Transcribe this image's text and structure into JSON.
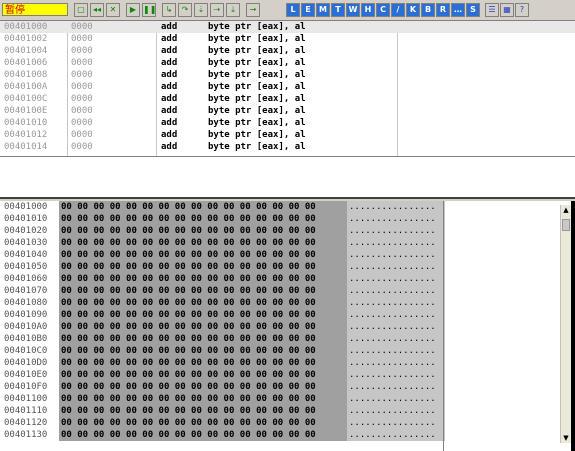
{
  "toolbar": {
    "status_label": "暂停",
    "buttons": [
      {
        "icon": "open-icon",
        "label": "▢"
      },
      {
        "icon": "restart-icon",
        "label": "◂◂"
      },
      {
        "icon": "close-icon",
        "label": "✕"
      },
      {
        "icon": "run-icon",
        "label": "▶"
      },
      {
        "icon": "pause-icon",
        "label": "❚❚"
      },
      {
        "icon": "step-into-icon",
        "label": "↳"
      },
      {
        "icon": "step-over-icon",
        "label": "↷"
      },
      {
        "icon": "trace-into-icon",
        "label": "⇣"
      },
      {
        "icon": "trace-over-icon",
        "label": "⇢"
      },
      {
        "icon": "execute-till-return-icon",
        "label": "⤓"
      },
      {
        "icon": "goto-icon",
        "label": "→"
      }
    ],
    "windows": [
      "L",
      "E",
      "M",
      "T",
      "W",
      "H",
      "C",
      "/",
      "K",
      "B",
      "R",
      "…",
      "S"
    ],
    "extras": [
      {
        "icon": "list-icon",
        "label": "☰"
      },
      {
        "icon": "options-icon",
        "label": "▦"
      },
      {
        "icon": "help-icon",
        "label": "?"
      }
    ]
  },
  "disasm": {
    "rows": [
      {
        "addr": "00401000",
        "hex": "0000",
        "mnemonic": "add",
        "operands": "byte ptr [eax], al"
      },
      {
        "addr": "00401002",
        "hex": "0000",
        "mnemonic": "add",
        "operands": "byte ptr [eax], al"
      },
      {
        "addr": "00401004",
        "hex": "0000",
        "mnemonic": "add",
        "operands": "byte ptr [eax], al"
      },
      {
        "addr": "00401006",
        "hex": "0000",
        "mnemonic": "add",
        "operands": "byte ptr [eax], al"
      },
      {
        "addr": "00401008",
        "hex": "0000",
        "mnemonic": "add",
        "operands": "byte ptr [eax], al"
      },
      {
        "addr": "0040100A",
        "hex": "0000",
        "mnemonic": "add",
        "operands": "byte ptr [eax], al"
      },
      {
        "addr": "0040100C",
        "hex": "0000",
        "mnemonic": "add",
        "operands": "byte ptr [eax], al"
      },
      {
        "addr": "0040100E",
        "hex": "0000",
        "mnemonic": "add",
        "operands": "byte ptr [eax], al"
      },
      {
        "addr": "00401010",
        "hex": "0000",
        "mnemonic": "add",
        "operands": "byte ptr [eax], al"
      },
      {
        "addr": "00401012",
        "hex": "0000",
        "mnemonic": "add",
        "operands": "byte ptr [eax], al"
      },
      {
        "addr": "00401014",
        "hex": "0000",
        "mnemonic": "add",
        "operands": "byte ptr [eax], al"
      }
    ]
  },
  "dump": {
    "bytes": "00 00 00 00 00 00 00 00 00 00 00 00 00 00 00 00",
    "ascii": "................",
    "rows": [
      "00401000",
      "00401010",
      "00401020",
      "00401030",
      "00401040",
      "00401050",
      "00401060",
      "00401070",
      "00401080",
      "00401090",
      "004010A0",
      "004010B0",
      "004010C0",
      "004010D0",
      "004010E0",
      "004010F0",
      "00401100",
      "00401110",
      "00401120",
      "00401130"
    ]
  },
  "scrollbar": {
    "up": "▲",
    "down": "▼"
  },
  "colors": {
    "status_bg": "#ffff00",
    "window_button_bg": "#2a6fd6",
    "hex_bg": "#a0a0a0",
    "ascii_bg": "#c6c6c6"
  }
}
